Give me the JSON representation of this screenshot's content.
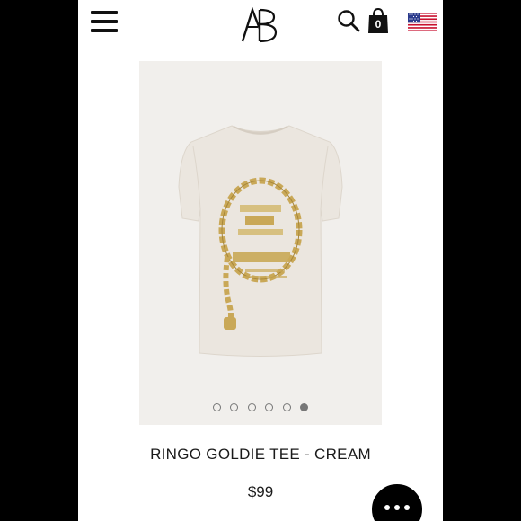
{
  "header": {
    "menu_icon": "hamburger-menu-icon",
    "logo_icon": "ab-monogram-logo",
    "search_icon": "search-icon",
    "bag_icon": "shopping-bag-icon",
    "bag_count": "0",
    "flag_icon": "us-flag-icon"
  },
  "gallery": {
    "image_count": 6,
    "active_index": 5
  },
  "product": {
    "title": "RINGO GOLDIE TEE - CREAM",
    "price": "$99"
  },
  "chat": {
    "icon": "chat-ellipsis-icon"
  },
  "colors": {
    "frame": "#000000",
    "page_bg": "#ffffff",
    "image_bg": "#f1efec",
    "tee": "#ebe6df",
    "gold": "#c9a857",
    "text": "#1a1a1a"
  }
}
